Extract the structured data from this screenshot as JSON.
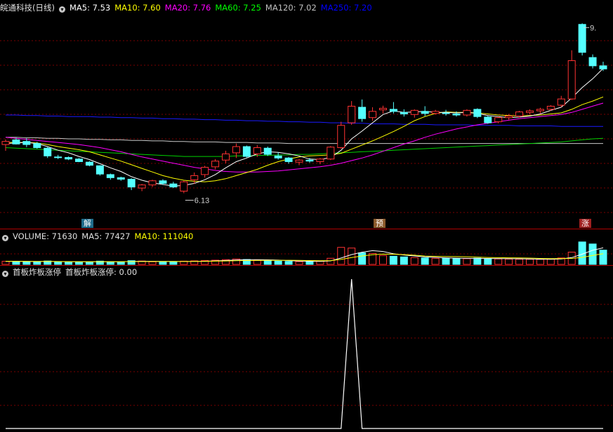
{
  "stock_title": "皖通科技(日线)",
  "main_legend": [
    {
      "text": "MA5: 7.53",
      "color": "#ffffff"
    },
    {
      "text": "MA10: 7.60",
      "color": "#ffff00"
    },
    {
      "text": "MA20: 7.76",
      "color": "#ff00ff"
    },
    {
      "text": "MA60: 7.25",
      "color": "#00ff00"
    },
    {
      "text": "MA120: 7.02",
      "color": "#c0c0c0"
    },
    {
      "text": "MA250: 7.20",
      "color": "#0000ff"
    }
  ],
  "volume_legend": [
    {
      "text": "VOLUME: 71630",
      "color": "#e0e0e0"
    },
    {
      "text": "MA5: 77427",
      "color": "#e0e0e0"
    },
    {
      "text": "MA10: 111040",
      "color": "#ffff00"
    }
  ],
  "indicator_legend": [
    {
      "text": "首板炸板涨停",
      "color": "#e0e0e0"
    },
    {
      "text": "首板炸板涨停: 0.00",
      "color": "#e0e0e0"
    }
  ],
  "labels": {
    "low_price": "6.13",
    "high_price": "9.",
    "mark_jie": "解",
    "mark_yu": "预",
    "mark_zhang": "涨"
  },
  "colors": {
    "up": "#ff3232",
    "down": "#54ffff",
    "grid": "#7a0000"
  },
  "chart_data": [
    {
      "type": "candlestick",
      "name": "price",
      "ohlc": [
        [
          7.38,
          7.48,
          7.26,
          7.44
        ],
        [
          7.47,
          7.51,
          7.38,
          7.39
        ],
        [
          7.44,
          7.5,
          7.33,
          7.38
        ],
        [
          7.4,
          7.43,
          7.3,
          7.32
        ],
        [
          7.31,
          7.33,
          7.12,
          7.16
        ],
        [
          7.14,
          7.18,
          7.1,
          7.13
        ],
        [
          7.13,
          7.15,
          7.08,
          7.1
        ],
        [
          7.1,
          7.12,
          7.04,
          7.05
        ],
        [
          7.04,
          7.06,
          6.96,
          6.98
        ],
        [
          6.97,
          6.98,
          6.78,
          6.81
        ],
        [
          6.8,
          6.82,
          6.7,
          6.74
        ],
        [
          6.74,
          6.76,
          6.68,
          6.71
        ],
        [
          6.71,
          6.73,
          6.5,
          6.56
        ],
        [
          6.54,
          6.62,
          6.48,
          6.6
        ],
        [
          6.6,
          6.7,
          6.56,
          6.68
        ],
        [
          6.68,
          6.71,
          6.6,
          6.63
        ],
        [
          6.62,
          6.66,
          6.54,
          6.56
        ],
        [
          6.48,
          6.68,
          6.44,
          6.66
        ],
        [
          6.7,
          6.84,
          6.62,
          6.78
        ],
        [
          6.8,
          6.97,
          6.74,
          6.94
        ],
        [
          6.95,
          7.1,
          6.9,
          7.06
        ],
        [
          7.08,
          7.26,
          7.02,
          7.2
        ],
        [
          7.22,
          7.4,
          7.12,
          7.34
        ],
        [
          7.34,
          7.36,
          7.13,
          7.15
        ],
        [
          7.2,
          7.37,
          7.14,
          7.32
        ],
        [
          7.31,
          7.34,
          7.16,
          7.19
        ],
        [
          7.16,
          7.23,
          7.09,
          7.12
        ],
        [
          7.12,
          7.14,
          7.01,
          7.05
        ],
        [
          7.04,
          7.1,
          6.98,
          7.08
        ],
        [
          7.08,
          7.12,
          7.03,
          7.06
        ],
        [
          7.05,
          7.12,
          7.0,
          7.1
        ],
        [
          7.1,
          7.35,
          7.08,
          7.33
        ],
        [
          7.32,
          7.82,
          7.3,
          7.75
        ],
        [
          7.8,
          8.22,
          7.76,
          8.12
        ],
        [
          8.1,
          8.25,
          7.82,
          7.88
        ],
        [
          7.9,
          8.1,
          7.84,
          8.02
        ],
        [
          8.05,
          8.13,
          7.98,
          8.08
        ],
        [
          8.06,
          8.2,
          7.98,
          8.02
        ],
        [
          8.0,
          8.06,
          7.92,
          7.97
        ],
        [
          7.96,
          8.06,
          7.9,
          8.04
        ],
        [
          8.02,
          8.12,
          7.93,
          7.98
        ],
        [
          7.98,
          8.05,
          7.96,
          8.02
        ],
        [
          7.99,
          8.05,
          7.94,
          7.98
        ],
        [
          7.97,
          8.02,
          7.92,
          7.95
        ],
        [
          7.95,
          8.06,
          7.92,
          8.04
        ],
        [
          8.06,
          8.08,
          7.89,
          7.92
        ],
        [
          7.91,
          7.93,
          7.78,
          7.8
        ],
        [
          7.82,
          7.92,
          7.79,
          7.9
        ],
        [
          7.9,
          7.97,
          7.86,
          7.93
        ],
        [
          7.93,
          8.03,
          7.9,
          8.01
        ],
        [
          8.0,
          8.06,
          7.96,
          8.03
        ],
        [
          8.03,
          8.09,
          7.98,
          8.06
        ],
        [
          8.06,
          8.14,
          8.03,
          8.12
        ],
        [
          8.14,
          8.32,
          8.1,
          8.26
        ],
        [
          8.26,
          9.2,
          8.24,
          9.0
        ],
        [
          9.7,
          9.72,
          9.1,
          9.16
        ],
        [
          9.06,
          9.12,
          8.85,
          8.9
        ],
        [
          8.9,
          8.98,
          8.8,
          8.84
        ]
      ],
      "ma": {
        "MA5": [
          7.4,
          7.41,
          7.42,
          7.4,
          7.34,
          7.27,
          7.22,
          7.15,
          7.09,
          7.01,
          6.93,
          6.86,
          6.76,
          6.69,
          6.64,
          6.61,
          6.58,
          6.59,
          6.63,
          6.7,
          6.8,
          6.93,
          7.05,
          7.12,
          7.2,
          7.24,
          7.23,
          7.2,
          7.16,
          7.1,
          7.09,
          7.13,
          7.27,
          7.49,
          7.64,
          7.8,
          7.96,
          8.03,
          8.0,
          8.01,
          8.02,
          8.0,
          8.0,
          7.99,
          8.0,
          7.98,
          7.94,
          7.92,
          7.9,
          7.91,
          7.93,
          7.97,
          8.04,
          8.1,
          8.28,
          8.48,
          8.65,
          8.85
        ],
        "MA10": [
          7.42,
          7.42,
          7.42,
          7.41,
          7.38,
          7.34,
          7.31,
          7.28,
          7.24,
          7.18,
          7.12,
          7.06,
          6.99,
          6.92,
          6.85,
          6.78,
          6.73,
          6.69,
          6.67,
          6.66,
          6.68,
          6.72,
          6.78,
          6.84,
          6.9,
          6.98,
          7.05,
          7.1,
          7.14,
          7.16,
          7.17,
          7.18,
          7.21,
          7.29,
          7.37,
          7.45,
          7.54,
          7.63,
          7.73,
          7.84,
          7.92,
          7.98,
          8.01,
          8.0,
          8.0,
          7.99,
          7.97,
          7.95,
          7.94,
          7.93,
          7.94,
          7.95,
          7.97,
          7.99,
          8.06,
          8.15,
          8.22,
          8.3
        ],
        "MA20": [
          7.52,
          7.5,
          7.48,
          7.46,
          7.44,
          7.42,
          7.4,
          7.38,
          7.35,
          7.32,
          7.28,
          7.24,
          7.19,
          7.14,
          7.1,
          7.06,
          7.02,
          6.98,
          6.94,
          6.91,
          6.88,
          6.86,
          6.85,
          6.85,
          6.85,
          6.86,
          6.87,
          6.89,
          6.91,
          6.93,
          6.95,
          6.98,
          7.02,
          7.07,
          7.12,
          7.18,
          7.25,
          7.32,
          7.39,
          7.45,
          7.52,
          7.58,
          7.63,
          7.68,
          7.72,
          7.76,
          7.79,
          7.82,
          7.85,
          7.88,
          7.9,
          7.92,
          7.94,
          7.96,
          8.0,
          8.06,
          8.12,
          8.18
        ],
        "MA60": [
          7.32,
          7.31,
          7.3,
          7.29,
          7.28,
          7.27,
          7.26,
          7.25,
          7.24,
          7.23,
          7.22,
          7.21,
          7.2,
          7.19,
          7.18,
          7.17,
          7.16,
          7.15,
          7.15,
          7.15,
          7.15,
          7.15,
          7.16,
          7.16,
          7.17,
          7.17,
          7.18,
          7.18,
          7.19,
          7.19,
          7.2,
          7.21,
          7.22,
          7.23,
          7.24,
          7.25,
          7.26,
          7.27,
          7.28,
          7.29,
          7.3,
          7.31,
          7.32,
          7.33,
          7.34,
          7.35,
          7.36,
          7.37,
          7.38,
          7.39,
          7.4,
          7.41,
          7.42,
          7.43,
          7.45,
          7.47,
          7.49,
          7.5
        ],
        "MA120": [
          7.52,
          7.52,
          7.51,
          7.51,
          7.5,
          7.5,
          7.49,
          7.49,
          7.48,
          7.48,
          7.47,
          7.47,
          7.46,
          7.46,
          7.45,
          7.45,
          7.44,
          7.44,
          7.43,
          7.43,
          7.43,
          7.42,
          7.42,
          7.42,
          7.41,
          7.41,
          7.41,
          7.4,
          7.4,
          7.4,
          7.4,
          7.4,
          7.4,
          7.4,
          7.4,
          7.4,
          7.4,
          7.4,
          7.4,
          7.4,
          7.4,
          7.4,
          7.4,
          7.4,
          7.4,
          7.4,
          7.4,
          7.4,
          7.4,
          7.4,
          7.4,
          7.4,
          7.4,
          7.4,
          7.4,
          7.4,
          7.4,
          7.4
        ],
        "MA250": [
          7.95,
          7.95,
          7.94,
          7.94,
          7.93,
          7.93,
          7.92,
          7.92,
          7.92,
          7.91,
          7.91,
          7.9,
          7.9,
          7.89,
          7.89,
          7.88,
          7.88,
          7.87,
          7.87,
          7.86,
          7.86,
          7.85,
          7.85,
          7.84,
          7.84,
          7.83,
          7.83,
          7.82,
          7.82,
          7.81,
          7.81,
          7.8,
          7.8,
          7.79,
          7.79,
          7.78,
          7.78,
          7.78,
          7.77,
          7.77,
          7.77,
          7.76,
          7.76,
          7.76,
          7.76,
          7.75,
          7.75,
          7.75,
          7.75,
          7.74,
          7.74,
          7.74,
          7.74,
          7.73,
          7.73,
          7.73,
          7.73,
          7.73
        ]
      }
    },
    {
      "type": "bar",
      "name": "volume",
      "values": [
        45,
        40,
        38,
        42,
        50,
        36,
        30,
        32,
        34,
        48,
        40,
        34,
        55,
        50,
        38,
        34,
        40,
        48,
        52,
        58,
        62,
        70,
        80,
        72,
        60,
        54,
        48,
        44,
        40,
        42,
        46,
        90,
        250,
        240,
        170,
        160,
        130,
        120,
        110,
        100,
        95,
        90,
        88,
        86,
        84,
        92,
        85,
        80,
        78,
        76,
        75,
        74,
        78,
        95,
        180,
        330,
        300,
        210
      ],
      "ma5": [
        44,
        43,
        42,
        41,
        43,
        41,
        39,
        38,
        38,
        38,
        38,
        39,
        44,
        45,
        45,
        44,
        43,
        42,
        44,
        46,
        52,
        58,
        64,
        69,
        69,
        67,
        63,
        56,
        49,
        46,
        44,
        52,
        94,
        144,
        179,
        202,
        190,
        156,
        138,
        124,
        111,
        103,
        96,
        92,
        89,
        88,
        87,
        85,
        83,
        82,
        80,
        76,
        75,
        80,
        100,
        150,
        207,
        243
      ],
      "ma10": [
        46,
        46,
        45,
        44,
        44,
        42,
        41,
        40,
        40,
        40,
        40,
        40,
        41,
        41,
        42,
        42,
        42,
        42,
        43,
        44,
        47,
        51,
        54,
        57,
        58,
        59,
        60,
        61,
        59,
        57,
        55,
        56,
        73,
        100,
        124,
        141,
        150,
        149,
        143,
        135,
        123,
        118,
        116,
        114,
        112,
        107,
        102,
        99,
        97,
        95,
        93,
        88,
        86,
        85,
        88,
        103,
        131,
        157
      ]
    },
    {
      "type": "line",
      "name": "首板炸板涨停",
      "values": [
        0,
        0,
        0,
        0,
        0,
        0,
        0,
        0,
        0,
        0,
        0,
        0,
        0,
        0,
        0,
        0,
        0,
        0,
        0,
        0,
        0,
        0,
        0,
        0,
        0,
        0,
        0,
        0,
        0,
        0,
        0,
        0,
        0,
        1,
        0,
        0,
        0,
        0,
        0,
        0,
        0,
        0,
        0,
        0,
        0,
        0,
        0,
        0,
        0,
        0,
        0,
        0,
        0,
        0,
        0,
        0,
        0,
        0
      ]
    }
  ]
}
